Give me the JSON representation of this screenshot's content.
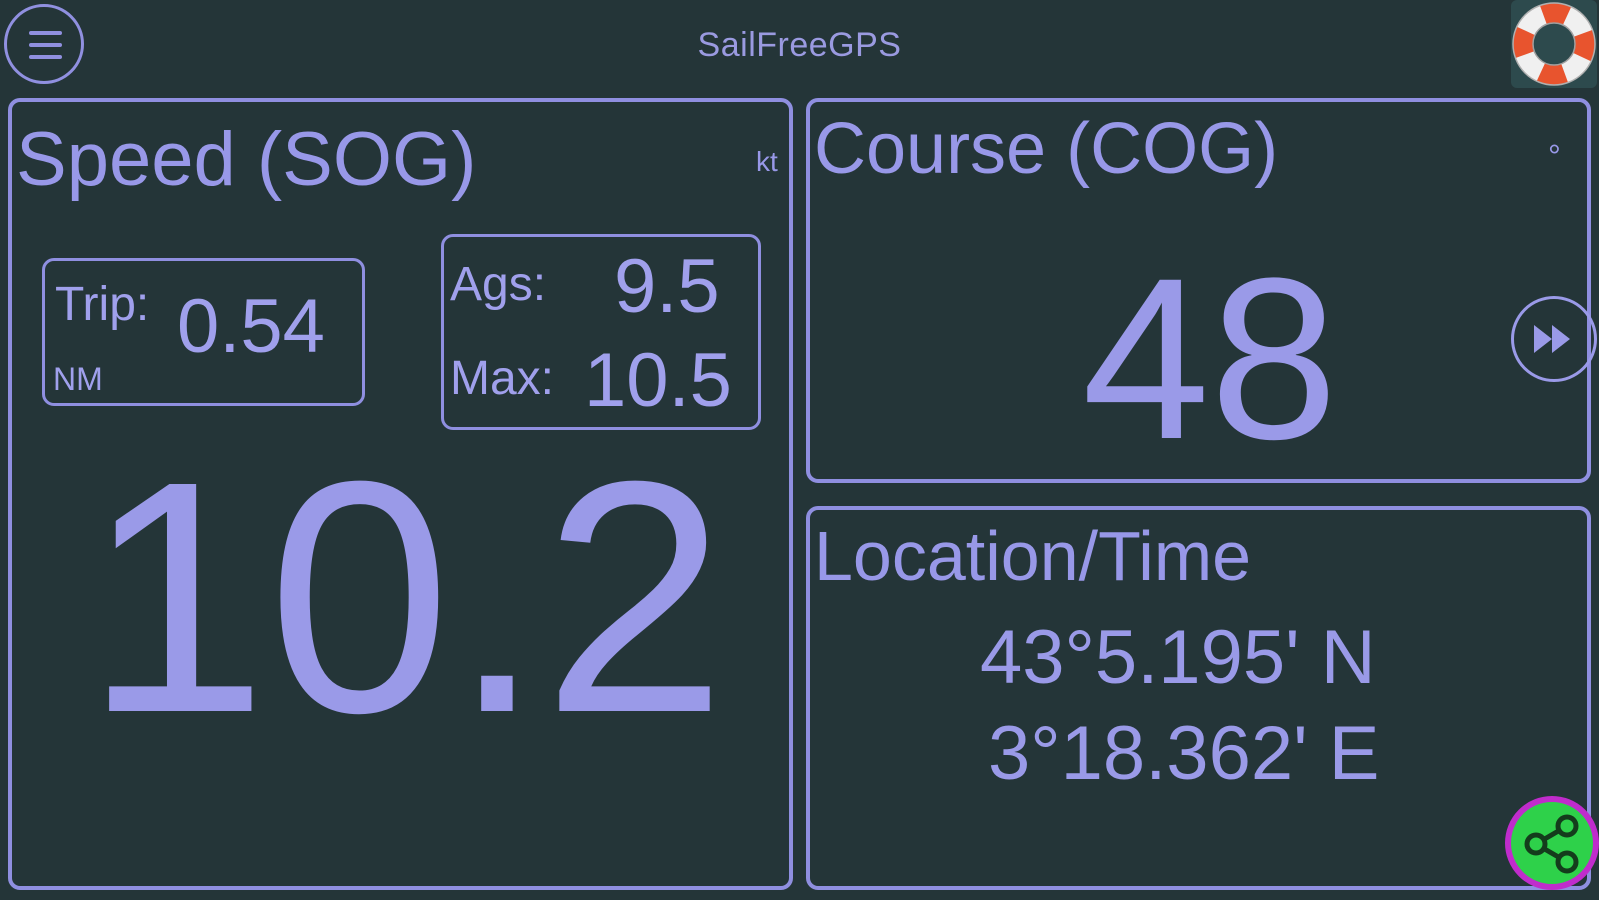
{
  "app": {
    "title": "SailFreeGPS"
  },
  "header": {
    "menu_icon": "hamburger-menu-icon",
    "help_icon": "lifebuoy-icon"
  },
  "speed": {
    "title": "Speed (SOG)",
    "unit": "kt",
    "value": "10.2",
    "trip": {
      "label": "Trip:",
      "value": "0.54",
      "unit": "NM"
    },
    "avg": {
      "label": "Ags:",
      "value": "9.5"
    },
    "max": {
      "label": "Max:",
      "value": "10.5"
    }
  },
  "course": {
    "title": "Course (COG)",
    "unit": "°",
    "value": "48",
    "next_icon": "fast-forward-icon"
  },
  "location": {
    "title": "Location/Time",
    "latitude": "43°5.195' N",
    "longitude": "3°18.362' E",
    "share_icon": "share-icon"
  },
  "colors": {
    "background": "#243538",
    "accent": "#9898e8",
    "share_fill": "#2ed14a",
    "share_ring": "#c02ccc"
  }
}
